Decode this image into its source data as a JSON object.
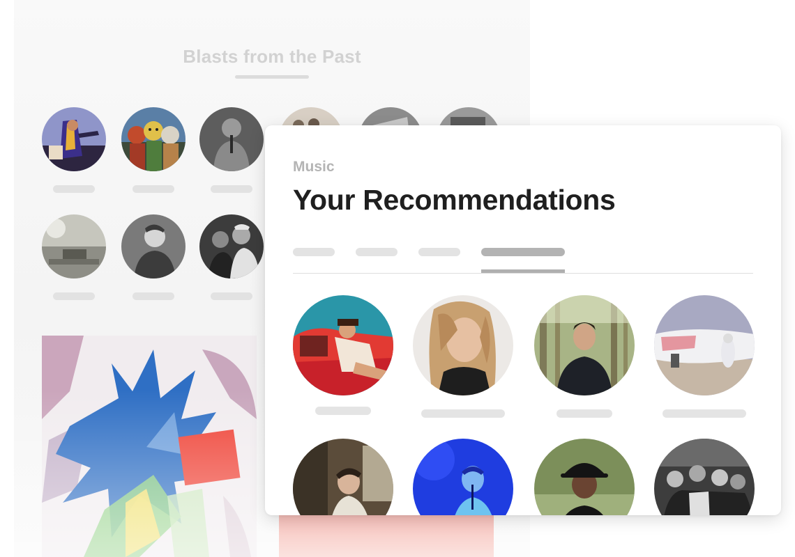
{
  "back": {
    "title": "Blasts from the Past",
    "avatars": [
      {
        "icon": "performer-photo"
      },
      {
        "icon": "masked-group-photo"
      },
      {
        "icon": "singer-bw-photo"
      },
      {
        "icon": "band-photo"
      },
      {
        "icon": "band-photo"
      },
      {
        "icon": "band-photo"
      },
      {
        "icon": "crowd-vintage-photo"
      },
      {
        "icon": "portrait-bw-photo"
      },
      {
        "icon": "group-bw-photo"
      }
    ],
    "album_art": "abstract-paint-album-cover"
  },
  "card": {
    "eyebrow": "Music",
    "title": "Your Recommendations",
    "tabs": [
      {
        "active": false
      },
      {
        "active": false
      },
      {
        "active": false
      },
      {
        "active": true
      }
    ],
    "recommendations": [
      {
        "icon": "artist-car-photo"
      },
      {
        "icon": "artist-portrait-photo"
      },
      {
        "icon": "artist-forest-photo"
      },
      {
        "icon": "artist-jet-photo"
      },
      {
        "icon": "artist-studio-photo"
      },
      {
        "icon": "artist-blue-stage-photo"
      },
      {
        "icon": "artist-bucket-hat-photo"
      },
      {
        "icon": "artist-group-bw-photo"
      }
    ]
  },
  "colors": {
    "title": "#1f1f1f",
    "eyebrow": "#b4b4b4",
    "placeholder": "#e3e3e3",
    "active_tab": "#b3b3b3"
  }
}
